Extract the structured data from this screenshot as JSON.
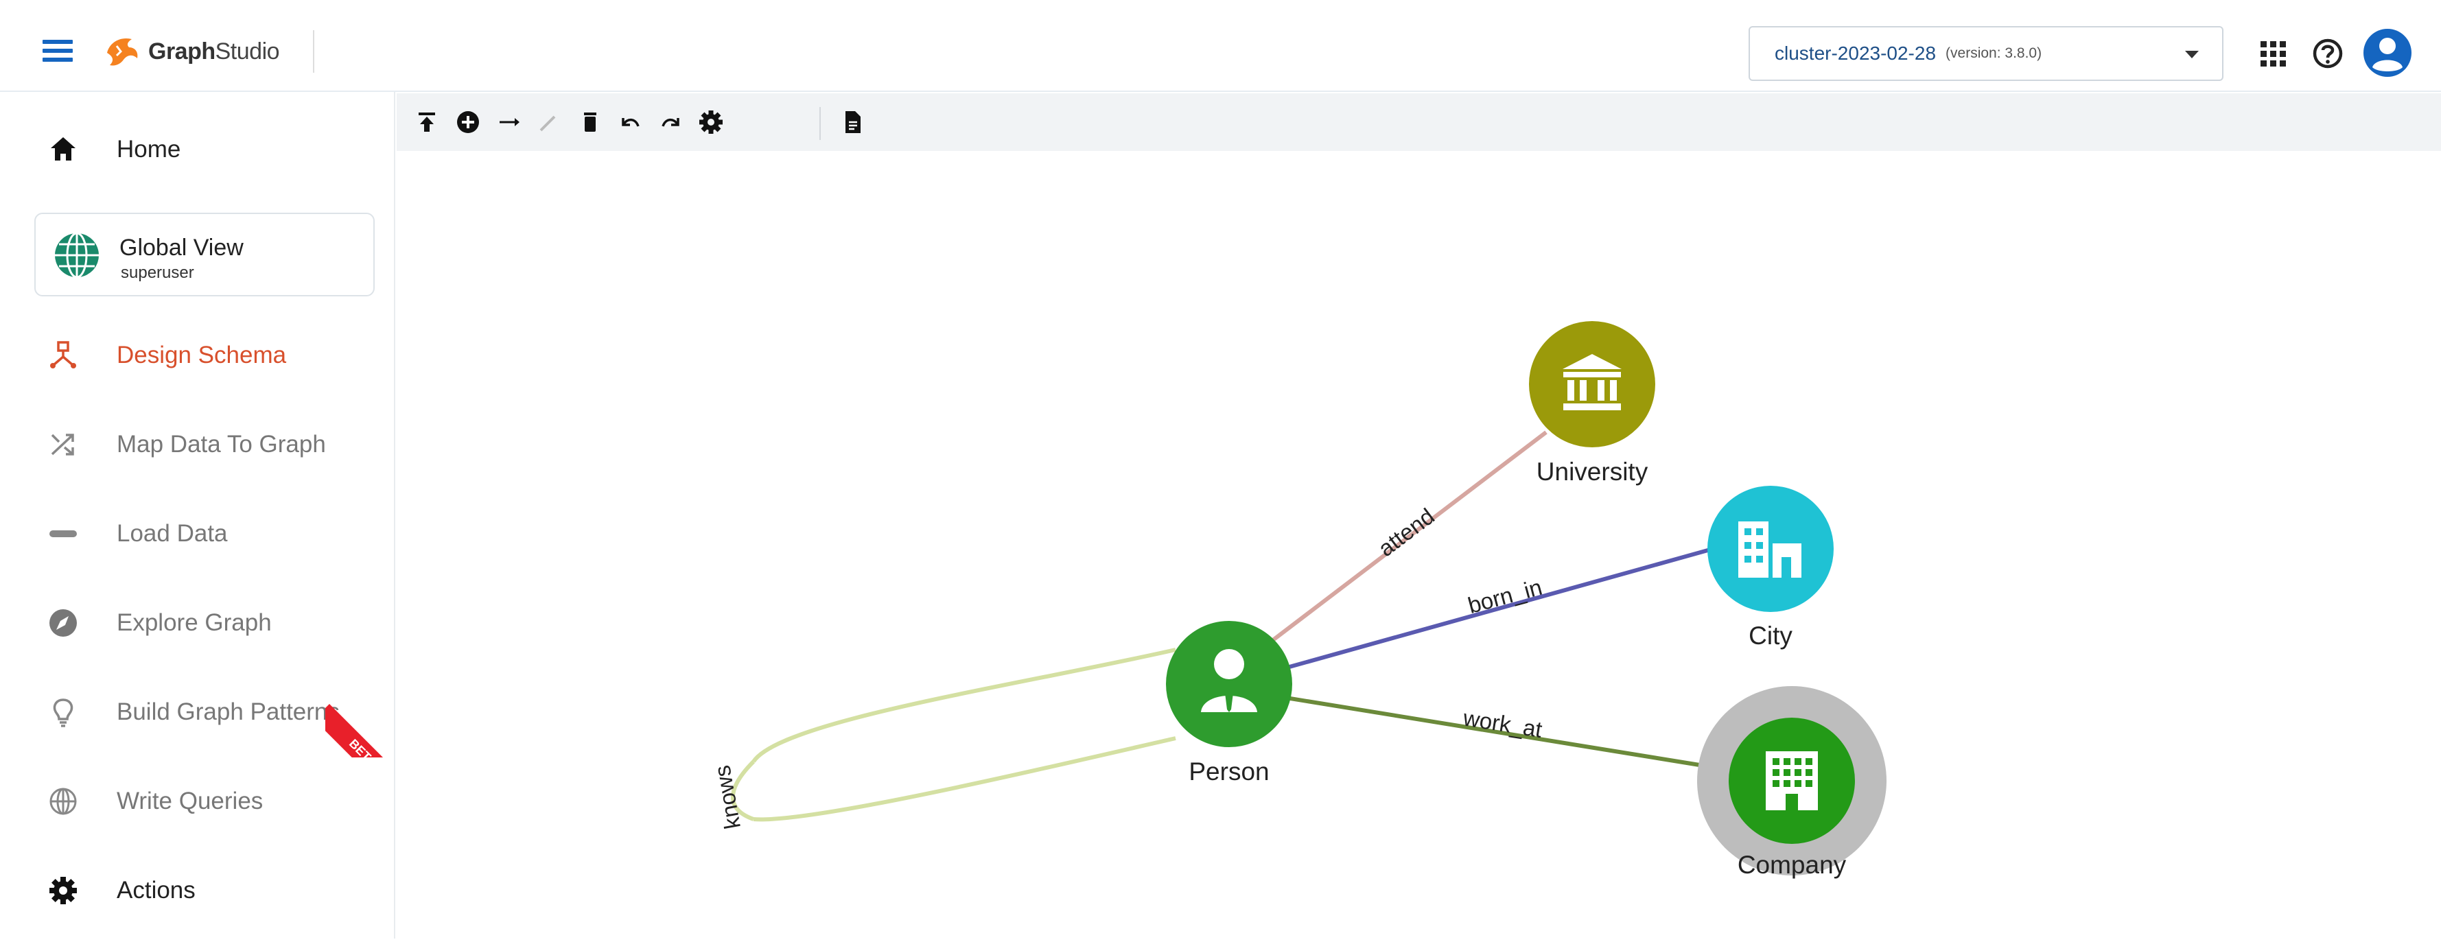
{
  "header": {
    "logo_text_bold": "Graph",
    "logo_text_light": "Studio",
    "cluster_name": "cluster-2023-02-28",
    "cluster_version": "(version: 3.8.0)",
    "icons": [
      "apps-grid-icon",
      "help-icon",
      "account-icon"
    ]
  },
  "sidebar": {
    "items": [
      {
        "label": "Home",
        "icon": "home-icon"
      },
      {
        "label": "Global View",
        "sub": "superuser",
        "icon": "globe-icon"
      },
      {
        "label": "Design Schema",
        "icon": "schema-icon",
        "active": true
      },
      {
        "label": "Map Data To Graph",
        "icon": "shuffle-icon"
      },
      {
        "label": "Load Data",
        "icon": "load-bar-icon"
      },
      {
        "label": "Explore Graph",
        "icon": "compass-icon"
      },
      {
        "label": "Build Graph Patterns",
        "icon": "lightbulb-icon",
        "badge": "BETA"
      },
      {
        "label": "Write Queries",
        "icon": "query-globe-icon"
      },
      {
        "label": "Actions",
        "icon": "gear-icon"
      }
    ]
  },
  "toolbar": {
    "icons": [
      "publish-icon",
      "add-vertex-icon",
      "add-edge-icon",
      "edit-icon",
      "delete-icon",
      "undo-icon",
      "redo-icon",
      "settings-icon",
      "document-icon"
    ]
  },
  "schema": {
    "vertices": [
      {
        "name": "University",
        "color": "#9b9a0a",
        "icon": "bank-icon"
      },
      {
        "name": "City",
        "color": "#1fc2d4",
        "icon": "city-icon"
      },
      {
        "name": "Person",
        "color": "#2e9c2e",
        "icon": "person-icon"
      },
      {
        "name": "Company",
        "color": "#239a17",
        "icon": "company-icon"
      }
    ],
    "edges": [
      {
        "name": "attend",
        "from": "Person",
        "to": "University",
        "color": "#d6a6a0"
      },
      {
        "name": "born_in",
        "from": "Person",
        "to": "City",
        "color": "#5a5ab0"
      },
      {
        "name": "work_at",
        "from": "Person",
        "to": "Company",
        "color": "#6b8a3a"
      },
      {
        "name": "knows",
        "from": "Person",
        "to": "Person",
        "color": "#d4e0a2"
      }
    ]
  }
}
